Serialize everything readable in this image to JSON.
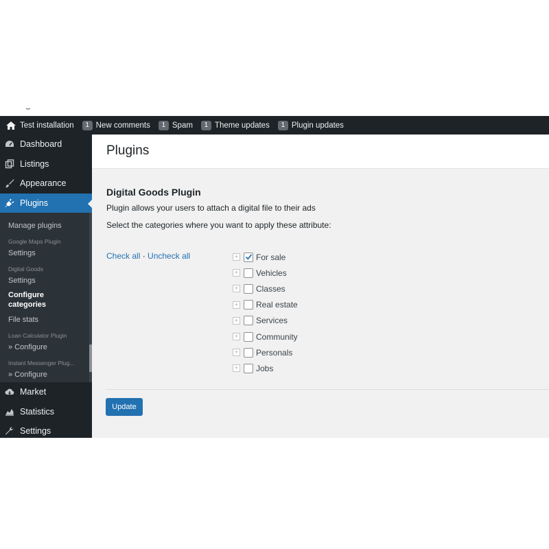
{
  "admin_bar": {
    "site_name": "Test installation",
    "items": [
      {
        "count": "1",
        "label": "New comments"
      },
      {
        "count": "1",
        "label": "Spam"
      },
      {
        "count": "1",
        "label": "Theme updates"
      },
      {
        "count": "1",
        "label": "Plugin updates"
      }
    ]
  },
  "sidebar": {
    "menu": [
      {
        "label": "Dashboard",
        "icon": "dashboard-icon"
      },
      {
        "label": "Listings",
        "icon": "listings-icon"
      },
      {
        "label": "Appearance",
        "icon": "brush-icon"
      },
      {
        "label": "Plugins",
        "icon": "plugin-icon",
        "active": true
      }
    ],
    "submenu": {
      "manage_plugins": "Manage plugins",
      "google_maps_head": "Google Maps Plugin",
      "google_maps_settings": "Settings",
      "digital_goods_head": "Digital Goods",
      "digital_goods_settings": "Settings",
      "configure_categories": "Configure categories",
      "file_stats": "File stats",
      "loan_head": "Loan Calculator Plugin",
      "loan_configure": "» Configure",
      "messenger_head": "Instant Messenger Plug...",
      "messenger_configure": "» Configure"
    },
    "menu_bottom": [
      {
        "label": "Market",
        "icon": "cloud-icon"
      },
      {
        "label": "Statistics",
        "icon": "chart-icon"
      },
      {
        "label": "Settings",
        "icon": "wrench-icon"
      }
    ]
  },
  "main": {
    "page_title": "Plugins",
    "plugin_title": "Digital Goods Plugin",
    "description": "Plugin allows your users to attach a digital file to their ads",
    "instruction": "Select the categories where you want to apply these attribute:",
    "check_all": "Check all",
    "separator": "·",
    "uncheck_all": "Uncheck all",
    "categories": [
      {
        "label": "For sale",
        "checked": true
      },
      {
        "label": "Vehicles",
        "checked": false
      },
      {
        "label": "Classes",
        "checked": false
      },
      {
        "label": "Real estate",
        "checked": false
      },
      {
        "label": "Services",
        "checked": false
      },
      {
        "label": "Community",
        "checked": false
      },
      {
        "label": "Personals",
        "checked": false
      },
      {
        "label": "Jobs",
        "checked": false
      }
    ],
    "expander_symbol": "+",
    "update_label": "Update"
  },
  "colors": {
    "admin_bar_bg": "#1d2327",
    "accent": "#2271b1",
    "content_bg": "#f1f1f1"
  }
}
